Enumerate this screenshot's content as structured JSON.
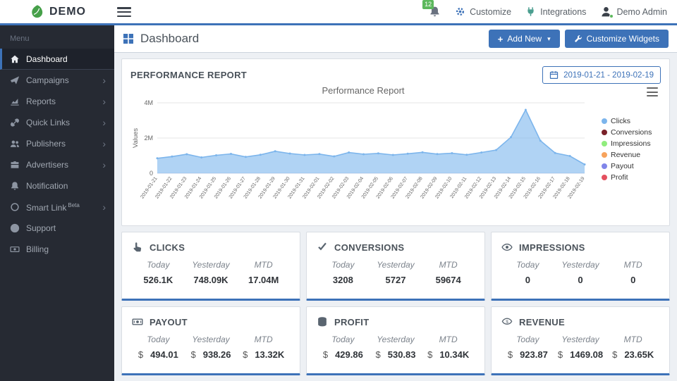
{
  "colors": {
    "accent": "#3d72b8",
    "sidebar_bg": "#262a33",
    "badge_green": "#5cb85c"
  },
  "navbar": {
    "logo_text": "DEMO",
    "notification_count": "12",
    "links": [
      {
        "id": "customize",
        "label": "Customize",
        "icon": "gear-icon"
      },
      {
        "id": "integrations",
        "label": "Integrations",
        "icon": "plug-icon"
      },
      {
        "id": "account",
        "label": "Demo Admin",
        "icon": "user-icon"
      }
    ]
  },
  "sidebar": {
    "menu_label": "Menu",
    "items": [
      {
        "label": "Dashboard",
        "icon": "home-icon",
        "active": true,
        "chevron": false
      },
      {
        "label": "Campaigns",
        "icon": "paper-plane-icon",
        "active": false,
        "chevron": true
      },
      {
        "label": "Reports",
        "icon": "line-chart-icon",
        "active": false,
        "chevron": true
      },
      {
        "label": "Quick Links",
        "icon": "link-icon",
        "active": false,
        "chevron": true
      },
      {
        "label": "Publishers",
        "icon": "users-icon",
        "active": false,
        "chevron": true
      },
      {
        "label": "Advertisers",
        "icon": "briefcase-icon",
        "active": false,
        "chevron": true
      },
      {
        "label": "Notification",
        "icon": "bell-icon",
        "active": false,
        "chevron": false
      },
      {
        "label": "Smart Link",
        "sup": "Beta",
        "icon": "circle-icon",
        "active": false,
        "chevron": true
      },
      {
        "label": "Support",
        "icon": "life-ring-icon",
        "active": false,
        "chevron": false
      },
      {
        "label": "Billing",
        "icon": "billing-icon",
        "active": false,
        "chevron": false
      }
    ]
  },
  "page_header": {
    "title": "Dashboard",
    "add_new_label": "Add New",
    "customize_widgets_label": "Customize Widgets"
  },
  "report_panel": {
    "title": "PERFORMANCE REPORT",
    "date_range": "2019-01-21 - 2019-02-19"
  },
  "chart_data": {
    "type": "area",
    "title": "Performance Report",
    "xlabel": "",
    "ylabel": "Values",
    "ylim": [
      0,
      4000000
    ],
    "grid": true,
    "legend_position": "right",
    "yticks": [
      {
        "v": 0,
        "label": "0"
      },
      {
        "v": 2000000,
        "label": "2M"
      },
      {
        "v": 4000000,
        "label": "4M"
      }
    ],
    "x": [
      "2019-01-21",
      "2019-01-22",
      "2019-01-23",
      "2019-01-24",
      "2019-01-25",
      "2019-01-26",
      "2019-01-27",
      "2019-01-28",
      "2019-01-29",
      "2019-01-30",
      "2019-01-31",
      "2019-02-01",
      "2019-02-02",
      "2019-02-03",
      "2019-02-04",
      "2019-02-05",
      "2019-02-06",
      "2019-02-07",
      "2019-02-08",
      "2019-02-09",
      "2019-02-10",
      "2019-02-11",
      "2019-02-12",
      "2019-02-13",
      "2019-02-14",
      "2019-02-15",
      "2019-02-16",
      "2019-02-17",
      "2019-02-18",
      "2019-02-19"
    ],
    "series": [
      {
        "name": "Clicks",
        "color": "#7cb5ec",
        "values": [
          850000,
          950000,
          1080000,
          900000,
          1020000,
          1100000,
          930000,
          1050000,
          1250000,
          1120000,
          1040000,
          1090000,
          960000,
          1180000,
          1080000,
          1130000,
          1040000,
          1110000,
          1190000,
          1090000,
          1140000,
          1050000,
          1180000,
          1320000,
          2050000,
          3600000,
          1850000,
          1150000,
          980000,
          500000
        ]
      }
    ],
    "legend": [
      {
        "name": "Clicks",
        "color": "#7cb5ec"
      },
      {
        "name": "Conversions",
        "color": "#7a2229"
      },
      {
        "name": "Impressions",
        "color": "#90ed7d"
      },
      {
        "name": "Revenue",
        "color": "#f7a35c"
      },
      {
        "name": "Payout",
        "color": "#8085e9"
      },
      {
        "name": "Profit",
        "color": "#e4505f"
      }
    ]
  },
  "stats_cards": [
    {
      "title": "CLICKS",
      "icon": "hand-pointer-icon",
      "prefix": "",
      "metrics": [
        {
          "label": "Today",
          "value": "526.1K"
        },
        {
          "label": "Yesterday",
          "value": "748.09K"
        },
        {
          "label": "MTD",
          "value": "17.04M"
        }
      ]
    },
    {
      "title": "CONVERSIONS",
      "icon": "check-icon",
      "prefix": "",
      "metrics": [
        {
          "label": "Today",
          "value": "3208"
        },
        {
          "label": "Yesterday",
          "value": "5727"
        },
        {
          "label": "MTD",
          "value": "59674"
        }
      ]
    },
    {
      "title": "IMPRESSIONS",
      "icon": "eye-icon",
      "prefix": "",
      "metrics": [
        {
          "label": "Today",
          "value": "0"
        },
        {
          "label": "Yesterday",
          "value": "0"
        },
        {
          "label": "MTD",
          "value": "0"
        }
      ]
    },
    {
      "title": "PAYOUT",
      "icon": "money-icon",
      "prefix": "$",
      "metrics": [
        {
          "label": "Today",
          "value": "494.01"
        },
        {
          "label": "Yesterday",
          "value": "938.26"
        },
        {
          "label": "MTD",
          "value": "13.32K"
        }
      ]
    },
    {
      "title": "PROFIT",
      "icon": "coins-icon",
      "prefix": "$",
      "metrics": [
        {
          "label": "Today",
          "value": "429.86"
        },
        {
          "label": "Yesterday",
          "value": "530.83"
        },
        {
          "label": "MTD",
          "value": "10.34K"
        }
      ]
    },
    {
      "title": "REVENUE",
      "icon": "revenue-eye-icon",
      "prefix": "$",
      "metrics": [
        {
          "label": "Today",
          "value": "923.87"
        },
        {
          "label": "Yesterday",
          "value": "1469.08"
        },
        {
          "label": "MTD",
          "value": "23.65K"
        }
      ]
    }
  ]
}
